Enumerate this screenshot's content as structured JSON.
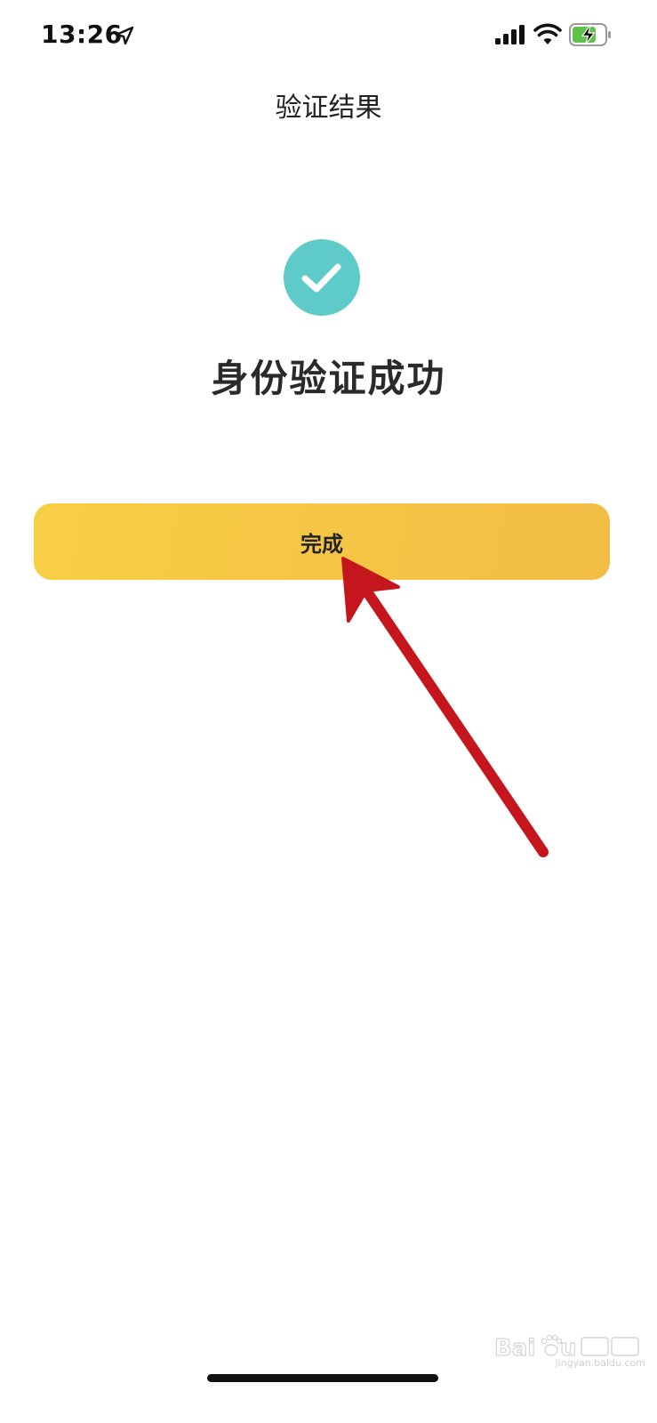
{
  "status_bar": {
    "time": "13:26",
    "icons": [
      "location-arrow-icon",
      "cellular-signal-icon",
      "wifi-icon",
      "battery-charging-icon"
    ]
  },
  "nav": {
    "title": "验证结果"
  },
  "result": {
    "icon": "success-check-icon",
    "message": "身份验证成功"
  },
  "done_button": {
    "label": "完成"
  },
  "colors": {
    "check_circle": "#5ecbc8",
    "button_start": "#f7cf45",
    "button_end": "#f2bd45",
    "arrow": "#c4161c"
  },
  "watermark": {
    "text": "jingyan.baidu.com"
  }
}
